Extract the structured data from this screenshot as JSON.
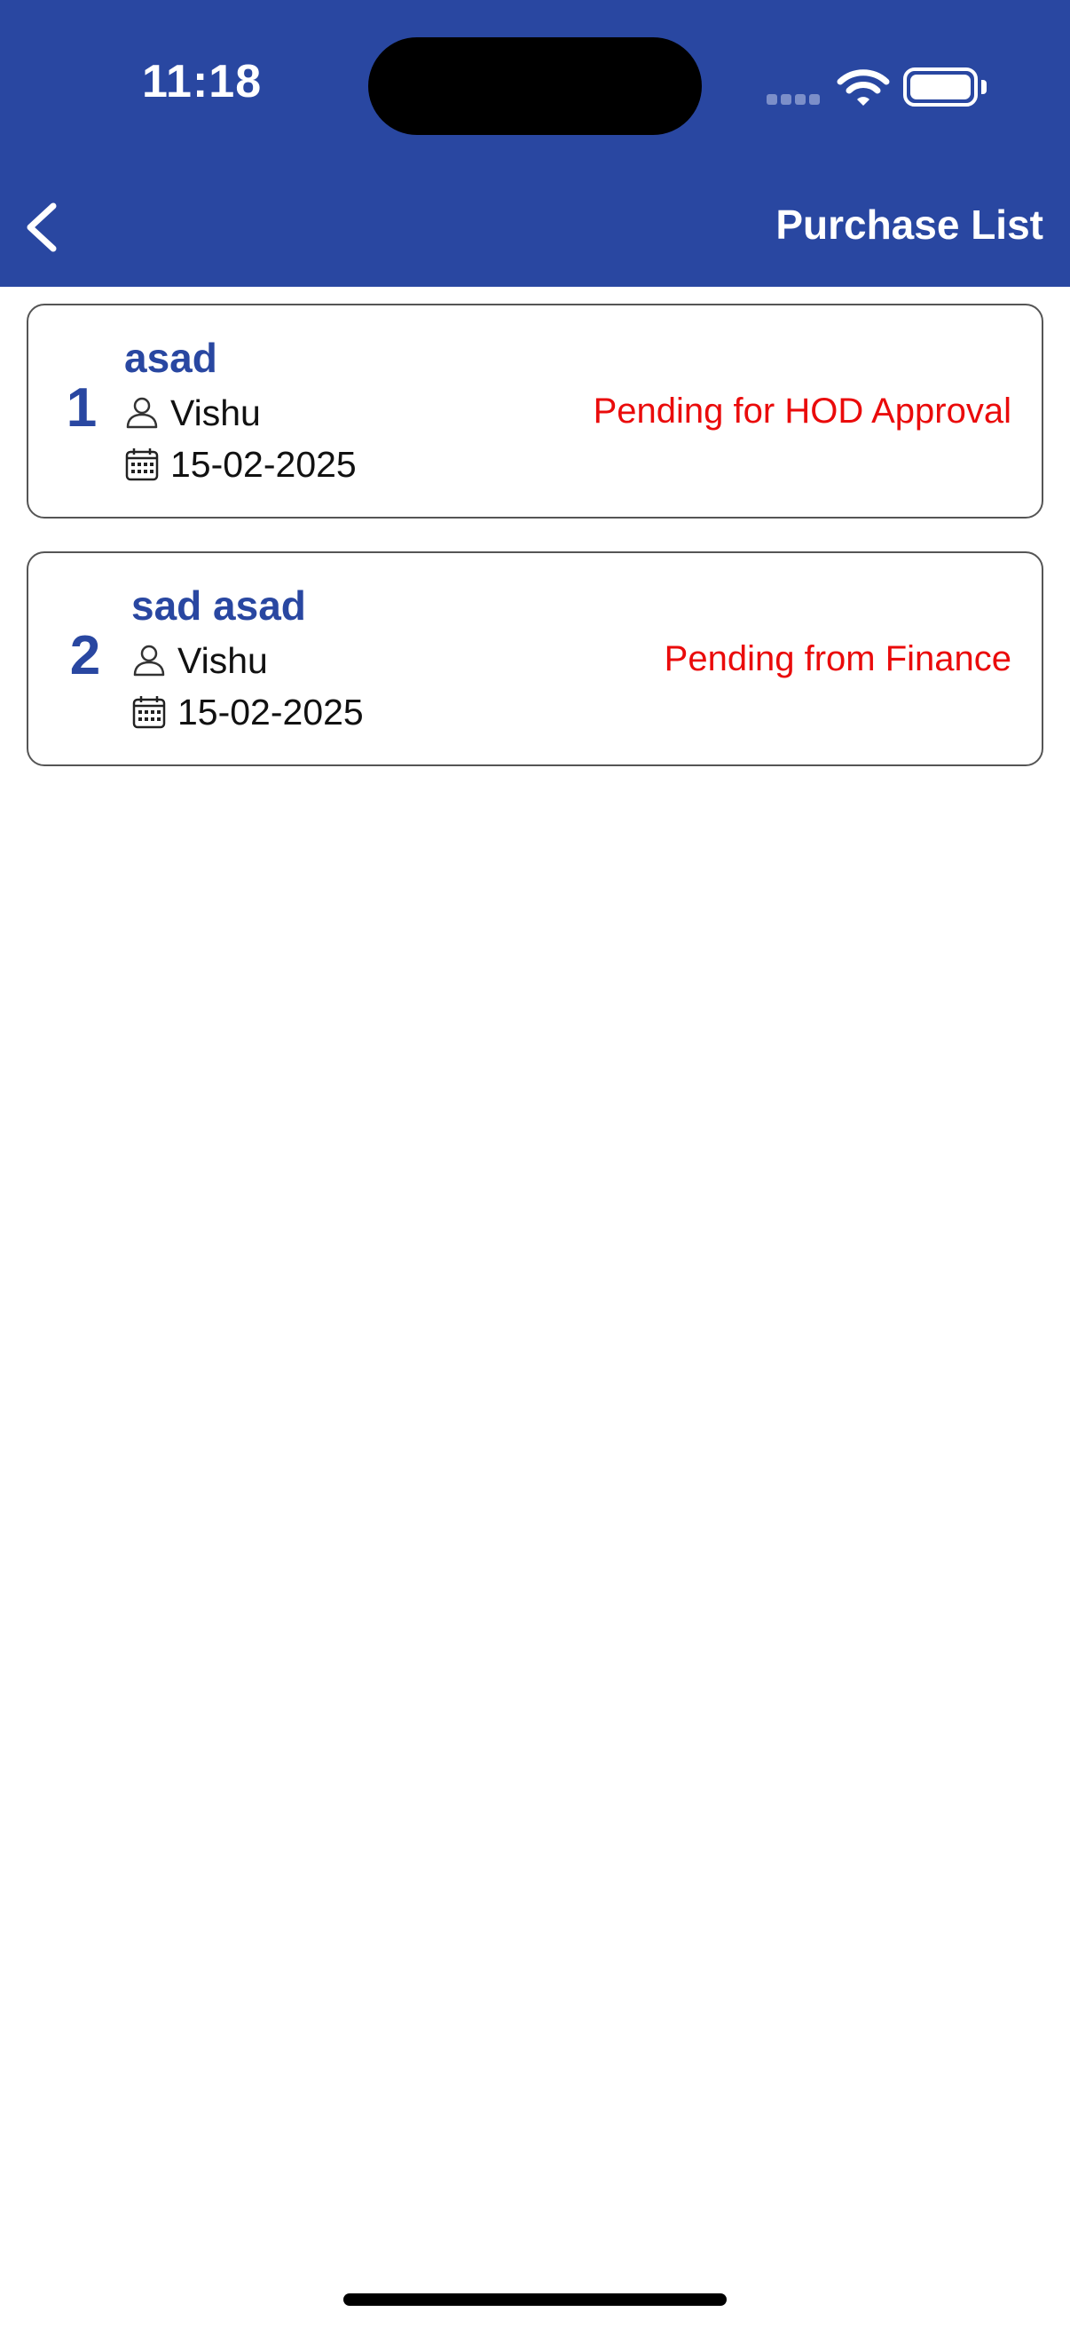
{
  "status_bar": {
    "time": "11:18"
  },
  "header": {
    "title": "Purchase List",
    "back_icon": "chevron-left-icon",
    "background_color": "#2947a1"
  },
  "purchases": [
    {
      "index": "1",
      "title": "asad",
      "user": "Vishu",
      "date": "15-02-2025",
      "status": "Pending for HOD Approval"
    },
    {
      "index": "2",
      "title": "sad asad",
      "user": "Vishu",
      "date": "15-02-2025",
      "status": "Pending from Finance"
    }
  ],
  "icons": {
    "user": "person-icon",
    "date": "calendar-icon"
  },
  "colors": {
    "accent": "#2947a1",
    "status": "#ea0b0b"
  }
}
